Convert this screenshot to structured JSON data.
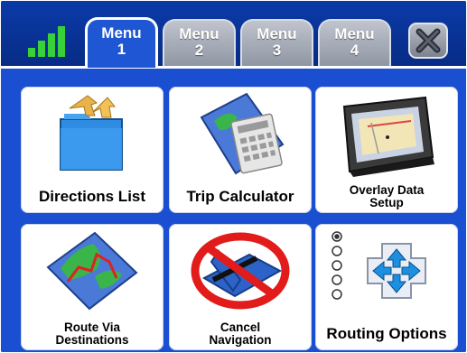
{
  "tabs": [
    {
      "line1": "Menu",
      "line2": "1",
      "active": true
    },
    {
      "line1": "Menu",
      "line2": "2",
      "active": false
    },
    {
      "line1": "Menu",
      "line2": "3",
      "active": false
    },
    {
      "line1": "Menu",
      "line2": "4",
      "active": false
    }
  ],
  "signal_icon": "signal-strength-icon",
  "close_icon": "close-icon",
  "tiles": [
    {
      "label": "Directions List",
      "icon": "directions-folder-icon"
    },
    {
      "label": "Trip Calculator",
      "icon": "calculator-map-icon"
    },
    {
      "label_line1": "Overlay Data",
      "label_line2": "Setup",
      "icon": "gps-device-icon"
    },
    {
      "label_line1": "Route Via",
      "label_line2": "Destinations",
      "icon": "route-map-icon"
    },
    {
      "label_line1": "Cancel",
      "label_line2": "Navigation",
      "icon": "no-route-icon"
    },
    {
      "label": "Routing Options",
      "icon": "routing-options-icon"
    }
  ],
  "colors": {
    "background": "#1a4fd1",
    "topbar": "#0a3aa8",
    "active_tab": "#1f56d4",
    "inactive_tab": "#a5abb6",
    "tile": "#ffffff"
  }
}
